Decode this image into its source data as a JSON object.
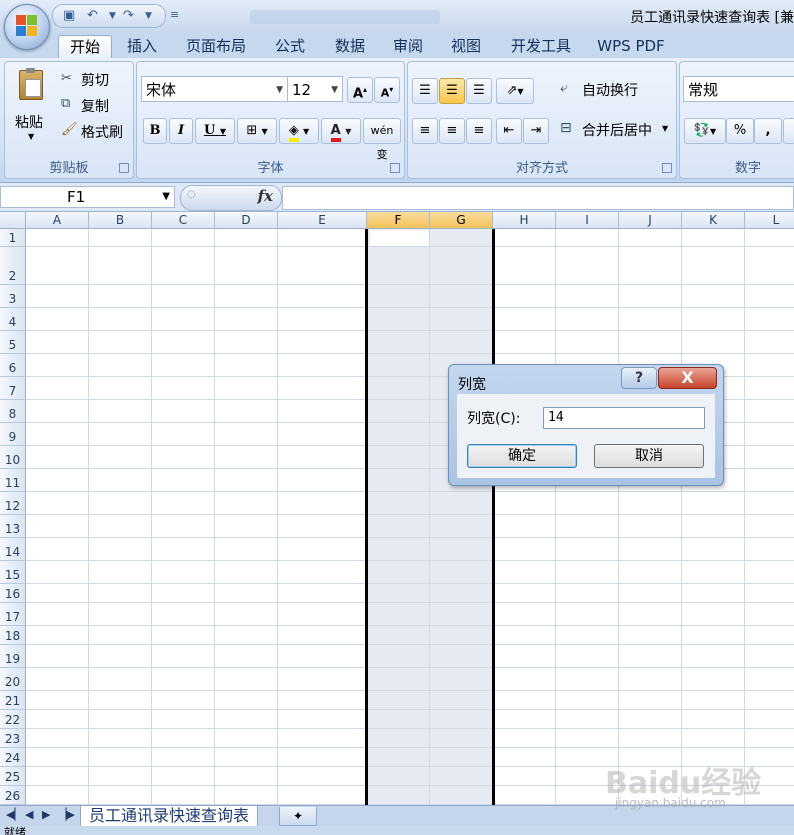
{
  "window": {
    "title": "员工通讯录快速查询表 [兼",
    "qat_icons": [
      "save-icon",
      "undo-icon",
      "redo-icon",
      "customize-icon"
    ]
  },
  "ribbon": {
    "tabs": [
      "开始",
      "插入",
      "页面布局",
      "公式",
      "数据",
      "审阅",
      "视图",
      "开发工具",
      "WPS PDF"
    ],
    "active_tab": "开始",
    "clipboard": {
      "label": "剪贴板",
      "paste": "粘贴",
      "cut": "剪切",
      "copy": "复制",
      "format_painter": "格式刷"
    },
    "font": {
      "label": "字体",
      "name": "宋体",
      "size": "12",
      "bold": "B",
      "italic": "I",
      "underline": "U",
      "font_color": "A",
      "phonetic": "wén 变"
    },
    "alignment": {
      "label": "对齐方式",
      "wrap_text": "自动换行",
      "merge_center": "合并后居中"
    },
    "number": {
      "label": "数字",
      "format": "常规",
      "percent": "%",
      "comma": ","
    }
  },
  "formula_bar": {
    "name_box": "F1",
    "fx": "fx",
    "formula": ""
  },
  "grid": {
    "columns": [
      "A",
      "B",
      "C",
      "D",
      "E",
      "F",
      "G",
      "H",
      "I",
      "J",
      "K",
      "L"
    ],
    "rows": [
      "1",
      "2",
      "3",
      "4",
      "5",
      "6",
      "7",
      "8",
      "9",
      "10",
      "11",
      "12",
      "13",
      "14",
      "15",
      "16",
      "17",
      "18",
      "19",
      "20",
      "21",
      "22",
      "23",
      "24",
      "25",
      "26"
    ],
    "selected_columns": [
      "F",
      "G"
    ]
  },
  "sheet_tabs": {
    "active": "员工通讯录快速查询表"
  },
  "status": {
    "text": "就绪"
  },
  "dialog": {
    "title": "列宽",
    "help": "?",
    "close": "X",
    "field_label": "列宽(C):",
    "field_value": "14",
    "ok": "确定",
    "cancel": "取消"
  },
  "watermark": {
    "brand": "Baidu经验",
    "url": "jingyan.baidu.com"
  }
}
